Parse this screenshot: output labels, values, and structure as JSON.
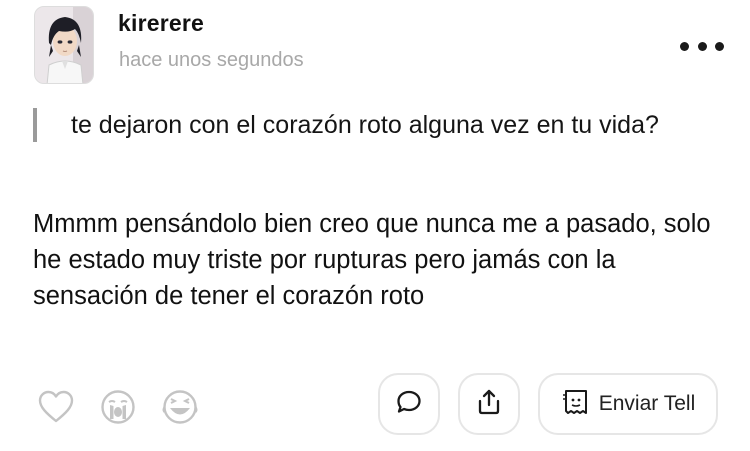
{
  "post": {
    "username": "kirerere",
    "timestamp": "hace unos segundos",
    "question": "te dejaron con el corazón roto alguna vez en tu vida?",
    "answer": "Mmmm pensándolo bien creo que nunca me a pasado, solo he estado muy triste por rupturas pero jamás con la sensación de tener el corazón roto"
  },
  "actions": {
    "send_tell_label": "Enviar Tell"
  },
  "icons": {
    "avatar": "avatar-image",
    "more": "more-options-icon",
    "like": "heart-icon",
    "crying": "crying-face-icon",
    "laughing": "laughing-face-icon",
    "comment": "comment-bubble-icon",
    "share": "share-icon",
    "tell": "tell-icon"
  },
  "colors": {
    "text": "#111111",
    "muted": "#a8a8a8",
    "icon_gray": "#c4c4c4",
    "quote_bar": "#9a9a9a",
    "border": "#e6e6e6"
  }
}
